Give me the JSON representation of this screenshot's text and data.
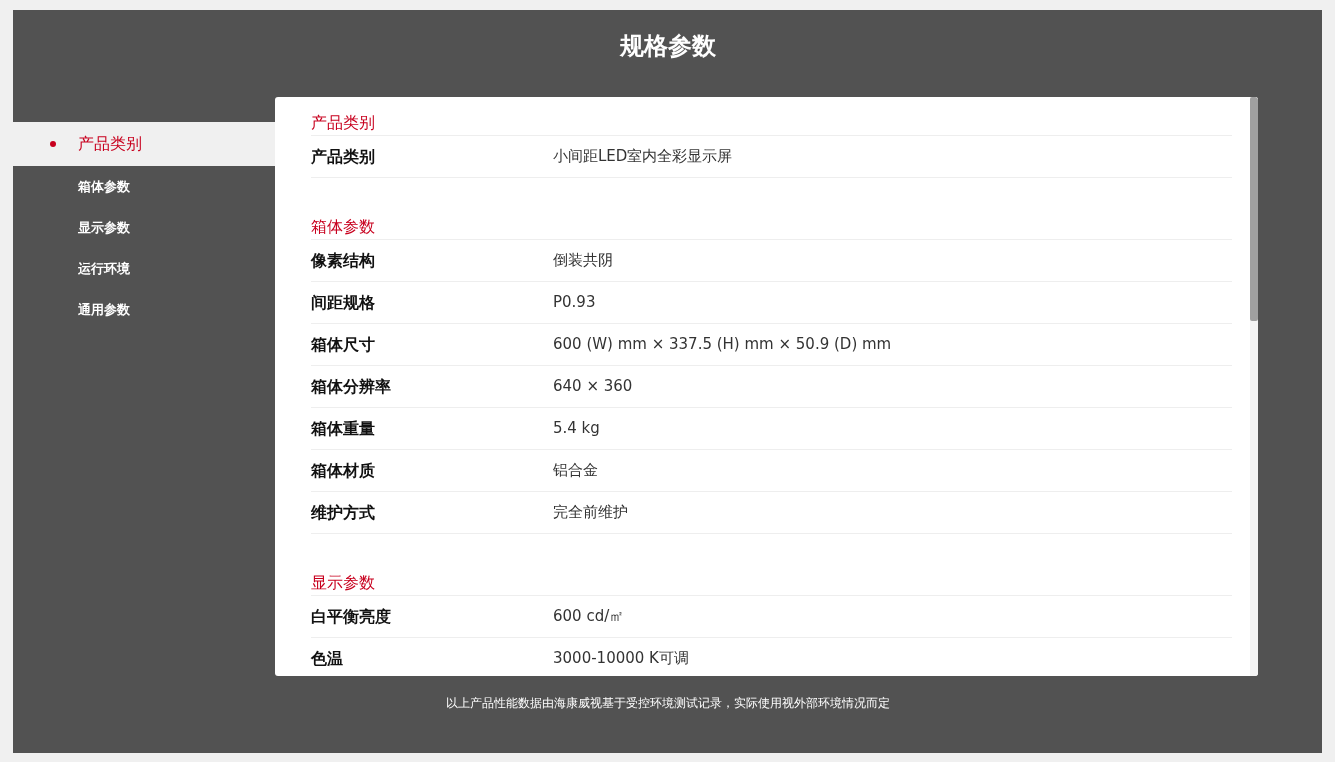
{
  "title": "规格参数",
  "sidebar": {
    "items": [
      {
        "label": "产品类别",
        "selected": true
      },
      {
        "label": "箱体参数",
        "selected": false
      },
      {
        "label": "显示参数",
        "selected": false
      },
      {
        "label": "运行环境",
        "selected": false
      },
      {
        "label": "通用参数",
        "selected": false
      }
    ]
  },
  "sections": [
    {
      "heading": "产品类别",
      "rows": [
        {
          "label": "产品类别",
          "value": "小间距LED室内全彩显示屏"
        }
      ]
    },
    {
      "heading": "箱体参数",
      "rows": [
        {
          "label": "像素结构",
          "value": "倒装共阴"
        },
        {
          "label": "间距规格",
          "value": "P0.93"
        },
        {
          "label": "箱体尺寸",
          "value": "600 (W) mm × 337.5 (H) mm × 50.9 (D) mm"
        },
        {
          "label": "箱体分辨率",
          "value": "640 × 360"
        },
        {
          "label": "箱体重量",
          "value": "5.4 kg"
        },
        {
          "label": "箱体材质",
          "value": "铝合金"
        },
        {
          "label": "维护方式",
          "value": "完全前维护"
        }
      ]
    },
    {
      "heading": "显示参数",
      "rows": [
        {
          "label": "白平衡亮度",
          "value": "600 cd/㎡"
        },
        {
          "label": "色温",
          "value": "3000-10000 K可调"
        }
      ]
    }
  ],
  "footnote": "以上产品性能数据由海康威视基于受控环境测试记录，实际使用视外部环境情况而定"
}
